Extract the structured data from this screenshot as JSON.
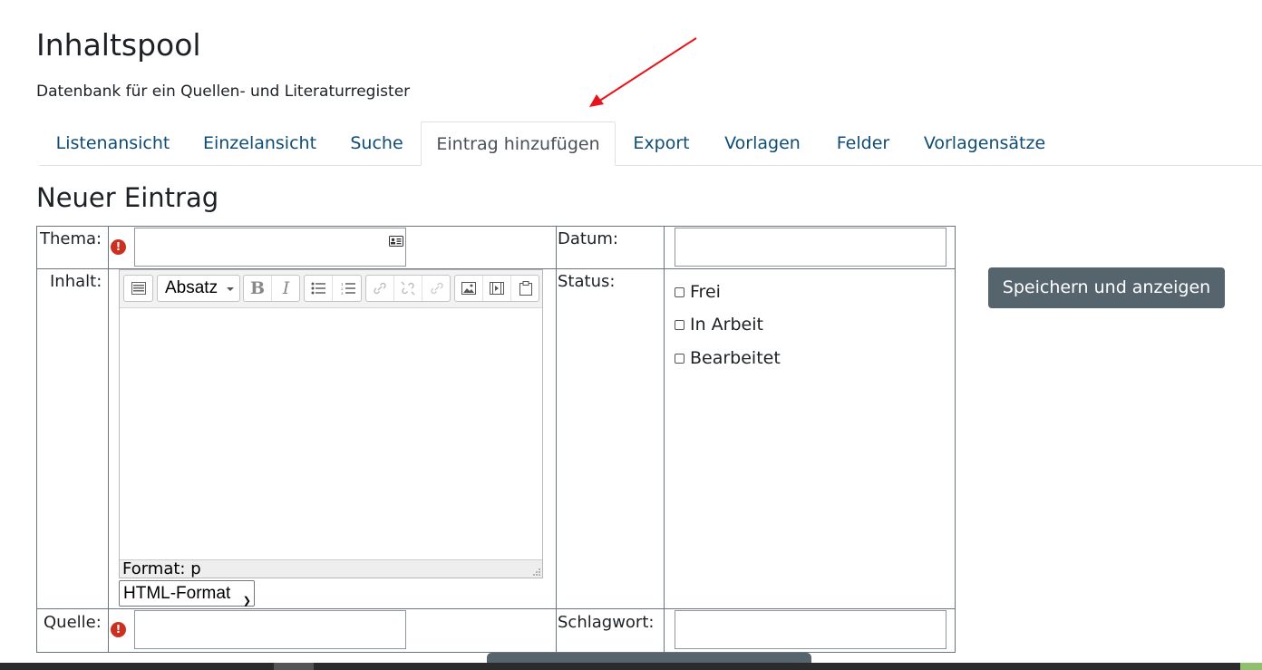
{
  "page": {
    "title": "Inhaltspool",
    "description": "Datenbank für ein Quellen- und Literaturregister"
  },
  "tabs": [
    {
      "label": "Listenansicht"
    },
    {
      "label": "Einzelansicht"
    },
    {
      "label": "Suche"
    },
    {
      "label": "Eintrag hinzufügen",
      "active": true
    },
    {
      "label": "Export"
    },
    {
      "label": "Vorlagen"
    },
    {
      "label": "Felder"
    },
    {
      "label": "Vorlagensätze"
    }
  ],
  "form": {
    "heading": "Neuer Eintrag",
    "thema_label": "Thema:",
    "datum_label": "Datum:",
    "inhalt_label": "Inhalt:",
    "status_label": "Status:",
    "quelle_label": "Quelle:",
    "schlagwort_label": "Schlagwort:",
    "thema_value": "",
    "datum_value": "",
    "quelle_value": "",
    "schlagwort_value": "",
    "status_options": [
      "Frei",
      "In Arbeit",
      "Bearbeitet"
    ],
    "required_icon": "!"
  },
  "editor": {
    "paragraph_style": "Absatz",
    "bold": "B",
    "italic": "I",
    "statusbar": "Format: p",
    "format_select": "HTML-Format",
    "icons": [
      "toolbar-toggle-icon",
      "bold-icon",
      "italic-icon",
      "bullet-list-icon",
      "numbered-list-icon",
      "link-icon",
      "unlink-icon",
      "anchor-icon",
      "image-icon",
      "media-icon",
      "paste-icon"
    ]
  },
  "actions": {
    "save_label": "Speichern und anzeigen"
  },
  "colors": {
    "tab_link": "#0f4c75",
    "button": "#56646d",
    "required": "#ca3120",
    "arrow": "#e8141b"
  }
}
